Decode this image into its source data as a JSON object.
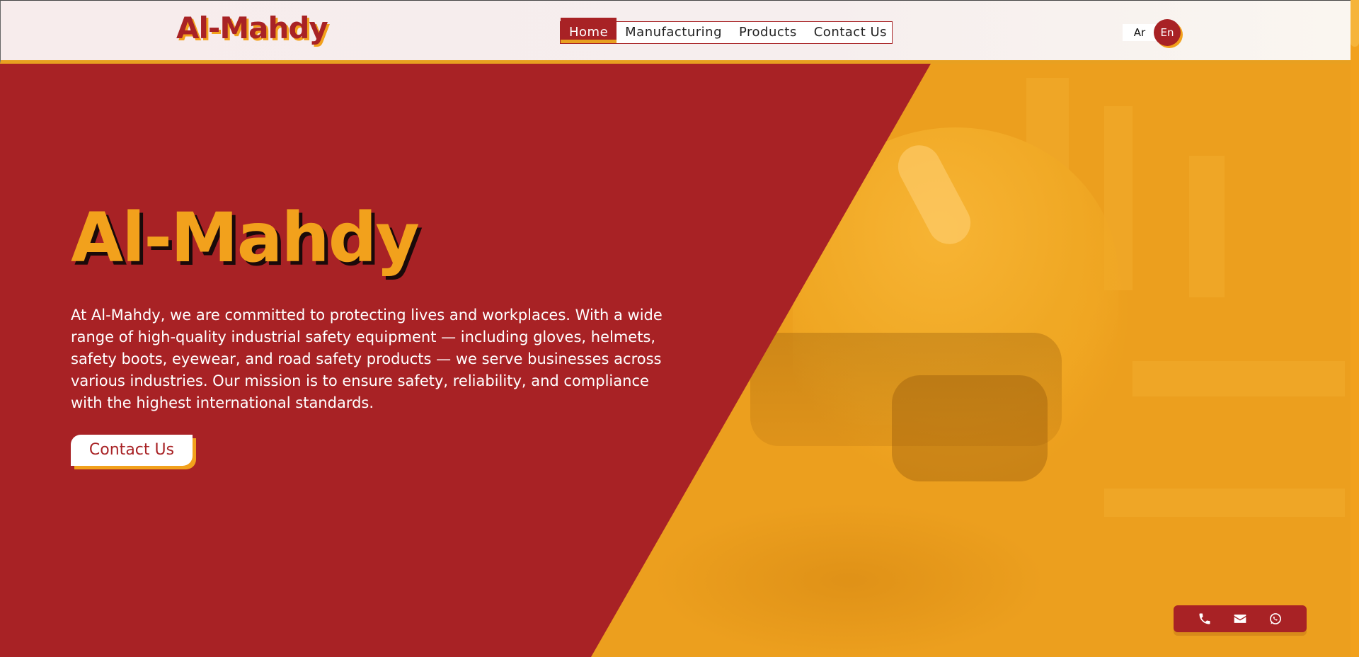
{
  "header": {
    "brand": "Al-Mahdy",
    "nav": [
      {
        "label": "Home",
        "active": true
      },
      {
        "label": "Manufacturing",
        "active": false
      },
      {
        "label": "Products",
        "active": false
      },
      {
        "label": "Contact Us",
        "active": false
      }
    ],
    "languages": {
      "ar": "Ar",
      "en": "En",
      "selected": "En"
    }
  },
  "hero": {
    "title": "Al-Mahdy",
    "description": "At Al-Mahdy, we are committed to protecting lives and workplaces. With a wide range of high-quality industrial safety equipment — including gloves, helmets, safety boots, eyewear, and road safety products — we serve businesses across various industries. Our mission is to ensure safety, reliability, and compliance with the highest international standards.",
    "cta_label": "Contact Us",
    "image_subject": "safety-helmet-with-earmuffs"
  },
  "contact_bar": {
    "icons": [
      "phone-icon",
      "mail-icon",
      "whatsapp-icon"
    ]
  },
  "colors": {
    "primary_red": "#a82225",
    "accent_orange": "#f2a11c",
    "header_bg": "#f7ecec"
  }
}
